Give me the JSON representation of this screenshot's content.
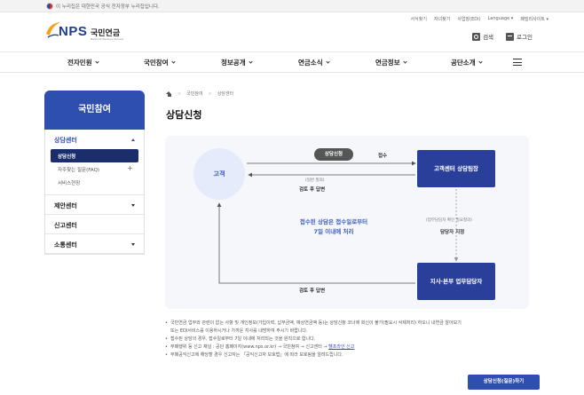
{
  "gov_bar": {
    "text": "이 누리집은 대한민국 공식 전자정부 누리집입니다."
  },
  "header": {
    "logo_text": "NPS",
    "logo_name": "국민연금",
    "logo_sub": "National Pension Service",
    "util_links": [
      "서식찾기",
      "자녀찾기",
      "사업장(EDI)",
      "Language ▾",
      "패밀리사이트 ▾"
    ],
    "search_label": "검색",
    "login_label": "로그인"
  },
  "gnb": {
    "items": [
      "전자민원",
      "국민참여",
      "정보공개",
      "연금소식",
      "연금정보",
      "공단소개"
    ]
  },
  "lnb": {
    "title": "국민참여",
    "groups": [
      {
        "label": "상담센터",
        "subs": [
          "상담신청",
          "자주찾는 질문(FAQ)",
          "서비스현장"
        ]
      },
      {
        "label": "제안센터"
      },
      {
        "label": "신고센터"
      },
      {
        "label": "소통센터"
      }
    ]
  },
  "breadcrumb": {
    "items": [
      "국민참여",
      "상담센터"
    ]
  },
  "page": {
    "title": "상담신청"
  },
  "diagram": {
    "customer": "고객",
    "apply_pill": "상담신청",
    "receive_label": "접수",
    "call_center": "고객센터 상담팀장",
    "general_question": "(일반 질의)",
    "review_answer_top": "검토 후 답변",
    "center_text_1": "접수된 상담은 접수일로부터",
    "center_text_2": "7일 이내에 처리",
    "need_check": "(업무담당자 확인 필요질의)",
    "assign_label": "담당자 지정",
    "branch_box": "지사·본부 업무담당자",
    "review_answer_bottom": "검토 후 답변"
  },
  "notes": {
    "items": [
      "국민연금 업무와 관련이 없는 사항 및 개인정보(가입이력, 납부금액, 예상연금액 등)는 상담신청 코너에 회신이 불가(필요시 삭제처리) 하오니 내연금 알아보기",
      "또는 EDI서비스를 이용하시거나 가까운 지사를 내방하여 주시기 바랍니다.",
      "접수된 상담의 경우, 접수일로부터 7일 이내에 처리되는 것을 원칙으로 합니다.",
      "부패행위 등 신고 채널 : 공단 홈페이지(www.nps.or.kr) → 국민참여 → 신고센터 →",
      "부패공익신고에 해당할 경우 신고자는 「공익신고자 보호법」에 따라 보호됨을 알려드립니다."
    ],
    "link_text": "헬프라인 신고"
  },
  "cta": {
    "label": "상담신청(질문)하기"
  },
  "colors": {
    "primary": "#2f4fb0",
    "navy": "#2a3f99",
    "customer_bg": "#e5ebfb",
    "panel_bg": "#f6f7fb"
  }
}
